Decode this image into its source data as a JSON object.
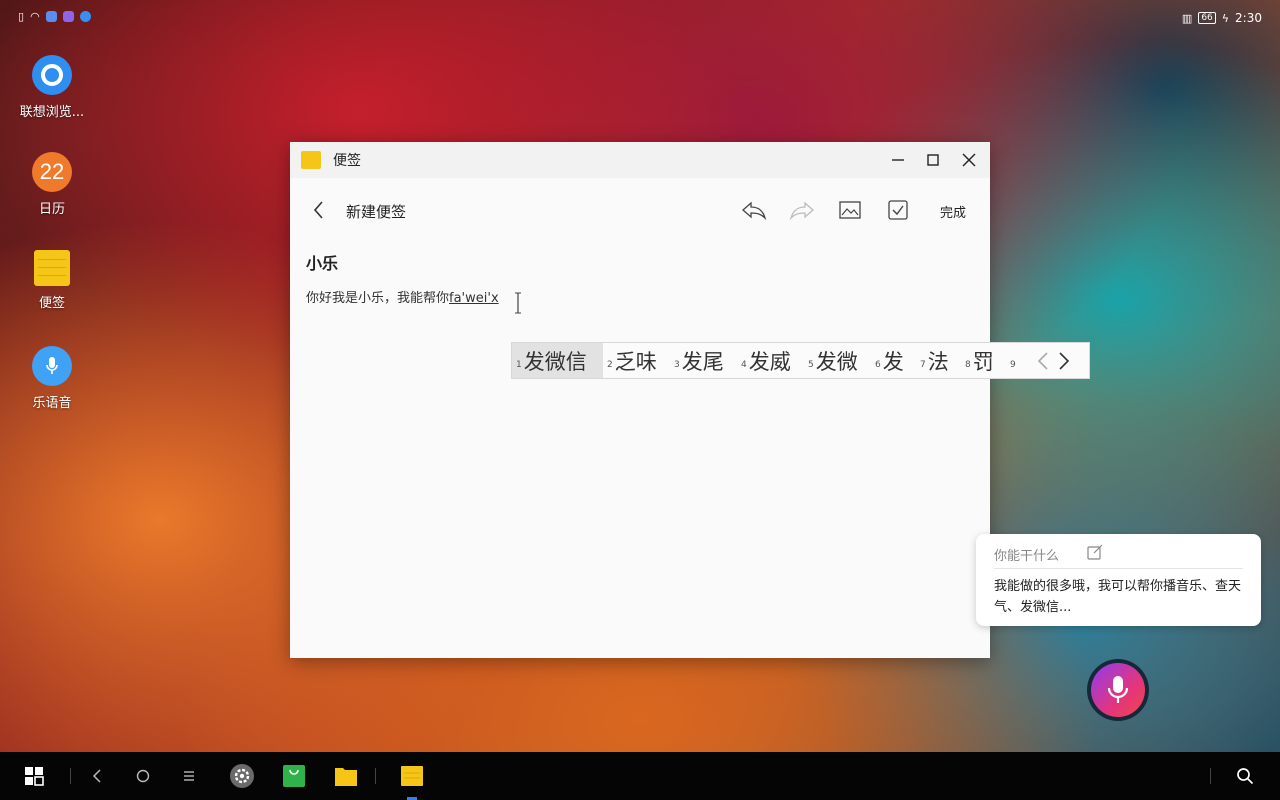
{
  "status_bar": {
    "time": "2:30",
    "battery": "66"
  },
  "desktop_icons": [
    {
      "label": "联想浏览..."
    },
    {
      "label": "日历",
      "day": "22"
    },
    {
      "label": "便签"
    },
    {
      "label": "乐语音"
    }
  ],
  "window": {
    "title": "便签",
    "toolbar": {
      "doc_title": "新建便签",
      "done_label": "完成"
    },
    "note": {
      "title": "小乐",
      "body_text": "你好我是小乐，我能帮你",
      "composition": "fa'wei'x"
    }
  },
  "ime": {
    "candidates": [
      {
        "n": "1",
        "text": "发微信"
      },
      {
        "n": "2",
        "text": "乏味"
      },
      {
        "n": "3",
        "text": "发尾"
      },
      {
        "n": "4",
        "text": "发威"
      },
      {
        "n": "5",
        "text": "发微"
      },
      {
        "n": "6",
        "text": "发"
      },
      {
        "n": "7",
        "text": "法"
      },
      {
        "n": "8",
        "text": "罚"
      },
      {
        "n": "9",
        "text": ""
      }
    ]
  },
  "assistant": {
    "question": "你能干什么",
    "answer": "我能做的很多哦，我可以帮你播音乐、查天气、发微信..."
  },
  "colors": {
    "accent": "#3a7bf0",
    "note_yellow": "#f5c518",
    "mic_gradient_start": "#8e3df0",
    "mic_gradient_end": "#f0454a"
  }
}
